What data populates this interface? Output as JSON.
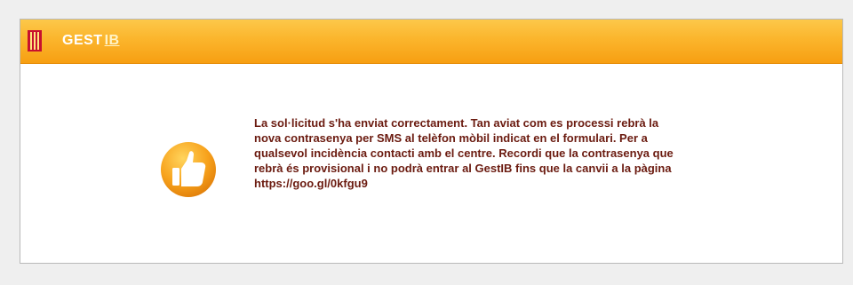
{
  "header": {
    "brand_main": "GEST",
    "brand_suffix": "IB",
    "accent_color": "#f9ad22"
  },
  "icons": {
    "logo": "institutional-bars-logo",
    "status": "thumbs-up-icon"
  },
  "message": {
    "text": "La sol·licitud s'ha enviat correctament. Tan aviat com es processi rebrà la nova contrasenya per SMS al telèfon mòbil indicat en el formulari. Per a qualsevol incidència contacti amb el centre. Recordi que la contrasenya que rebrà és provisional i no podrà entrar al GestIB fins que la canvii a la pàgina https://goo.gl/0kfgu9",
    "text_color": "#6b1b10"
  }
}
